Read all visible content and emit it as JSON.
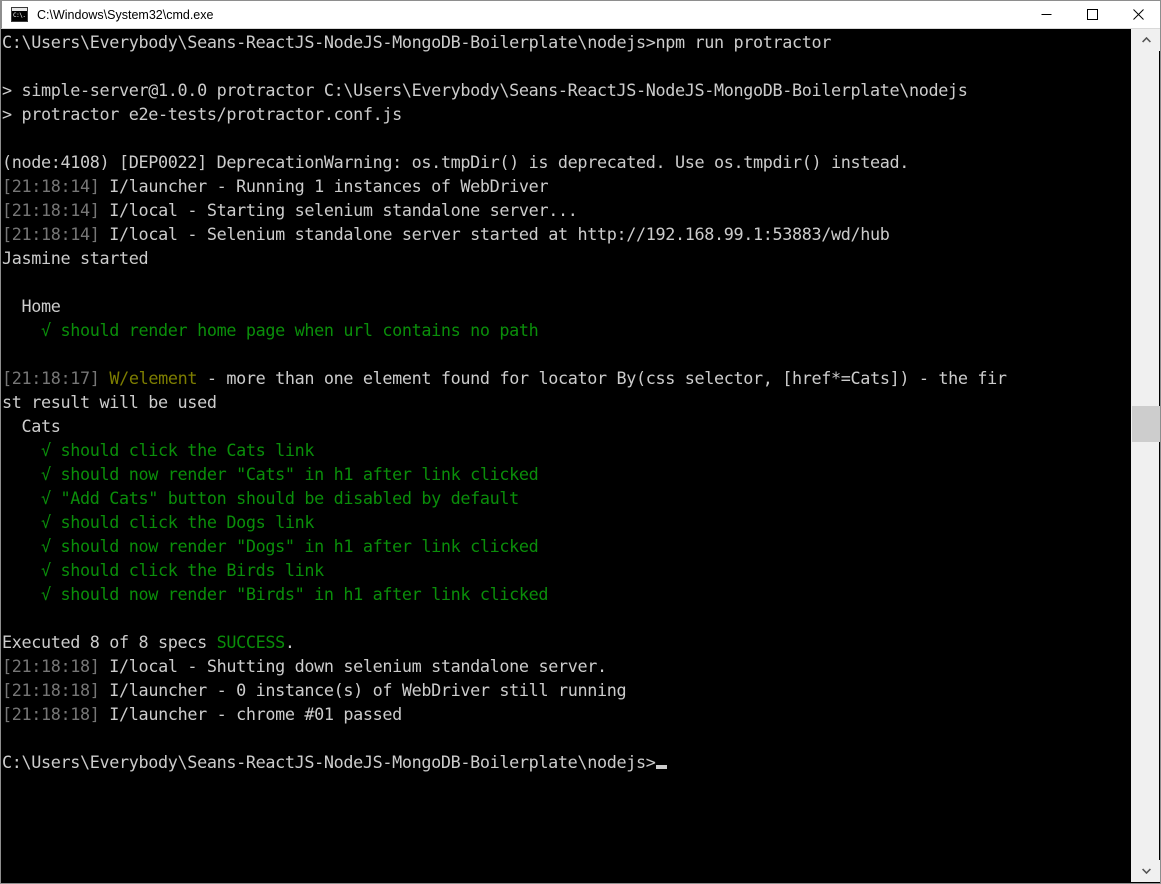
{
  "window": {
    "title": "C:\\Windows\\System32\\cmd.exe",
    "icon": "cmd-console-icon",
    "controls": {
      "minimize_label": "Minimize",
      "maximize_label": "Maximize",
      "close_label": "Close"
    }
  },
  "colors": {
    "background": "#000000",
    "foreground": "#cccccc",
    "green": "#0a8e0a",
    "gray": "#767676",
    "olive": "#7d7d00",
    "titlebar": "#ffffff",
    "scrollbar_track": "#f0f0f0",
    "scrollbar_thumb": "#cdcdcd",
    "window_border": "#8e8e8e"
  },
  "scrollbar": {
    "up_arrow": "chevron-up-icon",
    "down_arrow": "chevron-down-icon",
    "thumb_position_pct": 44
  },
  "terminal": {
    "prompt_path": "C:\\Users\\Everybody\\Seans-ReactJS-NodeJS-MongoDB-Boilerplate\\nodejs>",
    "command": "npm run protractor",
    "cursor": "_",
    "lines": [
      {
        "id": "l00",
        "segments": [
          {
            "text": "C:\\Users\\Everybody\\Seans-ReactJS-NodeJS-MongoDB-Boilerplate\\nodejs>npm run protractor",
            "color": "white"
          }
        ]
      },
      {
        "id": "l01",
        "segments": [
          {
            "text": "",
            "color": "white"
          }
        ]
      },
      {
        "id": "l02",
        "segments": [
          {
            "text": "> simple-server@1.0.0 protractor C:\\Users\\Everybody\\Seans-ReactJS-NodeJS-MongoDB-Boilerplate\\nodejs",
            "color": "white"
          }
        ]
      },
      {
        "id": "l03",
        "segments": [
          {
            "text": "> protractor e2e-tests/protractor.conf.js",
            "color": "white"
          }
        ]
      },
      {
        "id": "l04",
        "segments": [
          {
            "text": "",
            "color": "white"
          }
        ]
      },
      {
        "id": "l05",
        "segments": [
          {
            "text": "(node:4108) [DEP0022] DeprecationWarning: os.tmpDir() is deprecated. Use os.tmpdir() instead.",
            "color": "white"
          }
        ]
      },
      {
        "id": "l06",
        "segments": [
          {
            "text": "[21:18:14]",
            "color": "gray"
          },
          {
            "text": " I/launcher - Running 1 instances of WebDriver",
            "color": "white"
          }
        ]
      },
      {
        "id": "l07",
        "segments": [
          {
            "text": "[21:18:14]",
            "color": "gray"
          },
          {
            "text": " I/local - Starting selenium standalone server...",
            "color": "white"
          }
        ]
      },
      {
        "id": "l08",
        "segments": [
          {
            "text": "[21:18:14]",
            "color": "gray"
          },
          {
            "text": " I/local - Selenium standalone server started at http://192.168.99.1:53883/wd/hub",
            "color": "white"
          }
        ]
      },
      {
        "id": "l09",
        "segments": [
          {
            "text": "Jasmine started",
            "color": "white"
          }
        ]
      },
      {
        "id": "l10",
        "segments": [
          {
            "text": "",
            "color": "white"
          }
        ]
      },
      {
        "id": "l11",
        "segments": [
          {
            "text": "  Home",
            "color": "white"
          }
        ]
      },
      {
        "id": "l12",
        "segments": [
          {
            "text": "    √ should render home page when url contains no path",
            "color": "green"
          }
        ]
      },
      {
        "id": "l13",
        "segments": [
          {
            "text": "",
            "color": "white"
          }
        ]
      },
      {
        "id": "l14",
        "segments": [
          {
            "text": "[21:18:17]",
            "color": "gray"
          },
          {
            "text": " ",
            "color": "white"
          },
          {
            "text": "W/element",
            "color": "olive"
          },
          {
            "text": " - more than one element found for locator By(css selector, [href*=Cats]) - the fir",
            "color": "white"
          }
        ]
      },
      {
        "id": "l15",
        "segments": [
          {
            "text": "st result will be used",
            "color": "white"
          }
        ]
      },
      {
        "id": "l16",
        "segments": [
          {
            "text": "  Cats",
            "color": "white"
          }
        ]
      },
      {
        "id": "l17",
        "segments": [
          {
            "text": "    √ should click the Cats link",
            "color": "green"
          }
        ]
      },
      {
        "id": "l18",
        "segments": [
          {
            "text": "    √ should now render \"Cats\" in h1 after link clicked",
            "color": "green"
          }
        ]
      },
      {
        "id": "l19",
        "segments": [
          {
            "text": "    √ \"Add Cats\" button should be disabled by default",
            "color": "green"
          }
        ]
      },
      {
        "id": "l20",
        "segments": [
          {
            "text": "    √ should click the Dogs link",
            "color": "green"
          }
        ]
      },
      {
        "id": "l21",
        "segments": [
          {
            "text": "    √ should now render \"Dogs\" in h1 after link clicked",
            "color": "green"
          }
        ]
      },
      {
        "id": "l22",
        "segments": [
          {
            "text": "    √ should click the Birds link",
            "color": "green"
          }
        ]
      },
      {
        "id": "l23",
        "segments": [
          {
            "text": "    √ should now render \"Birds\" in h1 after link clicked",
            "color": "green"
          }
        ]
      },
      {
        "id": "l24",
        "segments": [
          {
            "text": "",
            "color": "white"
          }
        ]
      },
      {
        "id": "l25",
        "segments": [
          {
            "text": "Executed 8 of 8 specs ",
            "color": "white"
          },
          {
            "text": "SUCCESS",
            "color": "green"
          },
          {
            "text": ".",
            "color": "white"
          }
        ]
      },
      {
        "id": "l26",
        "segments": [
          {
            "text": "[21:18:18]",
            "color": "gray"
          },
          {
            "text": " I/local - Shutting down selenium standalone server.",
            "color": "white"
          }
        ]
      },
      {
        "id": "l27",
        "segments": [
          {
            "text": "[21:18:18]",
            "color": "gray"
          },
          {
            "text": " I/launcher - 0 instance(s) of WebDriver still running",
            "color": "white"
          }
        ]
      },
      {
        "id": "l28",
        "segments": [
          {
            "text": "[21:18:18]",
            "color": "gray"
          },
          {
            "text": " I/launcher - chrome #01 passed",
            "color": "white"
          }
        ]
      },
      {
        "id": "l29",
        "segments": [
          {
            "text": "",
            "color": "white"
          }
        ]
      },
      {
        "id": "l30",
        "segments": [
          {
            "text": "C:\\Users\\Everybody\\Seans-ReactJS-NodeJS-MongoDB-Boilerplate\\nodejs>",
            "color": "white"
          },
          {
            "text": "__CURSOR__",
            "color": "cursor"
          }
        ]
      }
    ]
  }
}
